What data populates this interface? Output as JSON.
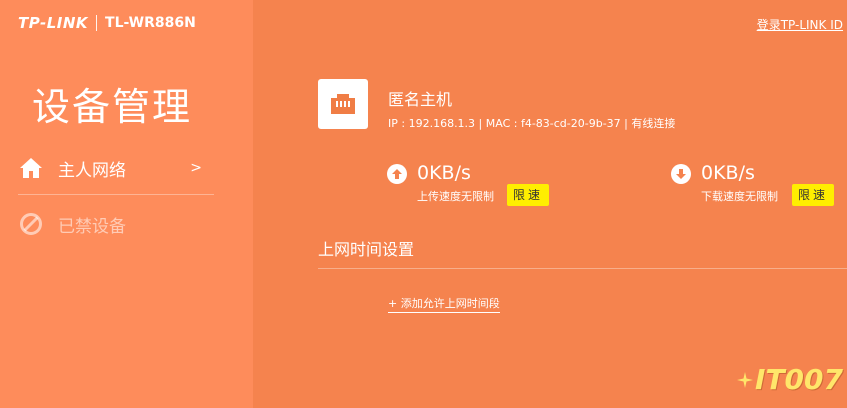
{
  "header": {
    "brand": "TP-LINK",
    "model": "TL-WR886N",
    "login_link": "登录TP-LINK ID"
  },
  "sidebar": {
    "title": "设备管理",
    "items": [
      {
        "label": "主人网络",
        "arrow": ">",
        "icon": "home-icon",
        "active": true
      },
      {
        "label": "已禁设备",
        "icon": "blocked-icon",
        "active": false
      }
    ]
  },
  "device": {
    "icon": "ethernet-port-icon",
    "name": "匿名主机",
    "info": "IP : 192.168.1.3 | MAC : f4-83-cd-20-9b-37 | 有线连接"
  },
  "speeds": {
    "upload": {
      "value": "0KB/s",
      "sub": "上传速度无限制",
      "button": "限速",
      "icon": "arrow-up-icon"
    },
    "download": {
      "value": "0KB/s",
      "sub": "下载速度无限制",
      "button": "限速",
      "icon": "arrow-down-icon"
    }
  },
  "schedule": {
    "title": "上网时间设置",
    "add_link": "+ 添加允许上网时间段"
  },
  "watermark": {
    "text": "IT007"
  },
  "colors": {
    "sidebar_bg": "#fe8c5b",
    "main_bg": "#f5834e",
    "limit_button": "#ffee00",
    "device_icon_bg": "#ffffff"
  }
}
